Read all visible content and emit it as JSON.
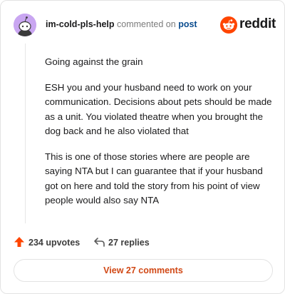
{
  "header": {
    "username": "im-cold-pls-help",
    "action": "commented on",
    "post_link": "post",
    "logo_text": "reddit"
  },
  "comment": {
    "paragraphs": [
      "Going against the grain",
      "ESH you and your husband need to work on your communication. Decisions about pets should be made as a unit. You violated theatre when you brought the dog back and he also violated that",
      "This is one of those stories where are people are saying NTA but I can guarantee that if your husband got on here and told the story from his point of view people would also say NTA"
    ]
  },
  "footer": {
    "upvotes": "234 upvotes",
    "replies": "27 replies",
    "view_comments": "View 27 comments"
  },
  "colors": {
    "brand": "#ff4500",
    "accent_text": "#d14815",
    "link": "#0a4c8f",
    "avatar_bg": "#c9a6f1"
  },
  "icons": {
    "avatar": "snoo-avatar-icon",
    "logo": "reddit-logo-icon",
    "upvote": "upvote-arrow-icon",
    "reply": "reply-arrow-icon"
  }
}
